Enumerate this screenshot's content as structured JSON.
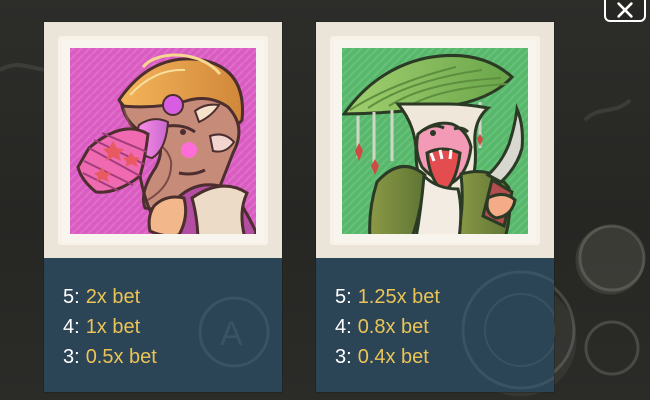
{
  "colors": {
    "background": "#2a2a27",
    "card_footer": "#2b4456",
    "payout_text": "#ebc457",
    "count_text": "#ffffff",
    "close_button": "#ffffff"
  },
  "ui": {
    "close_icon": "close-icon"
  },
  "symbols": [
    {
      "name": "monkey-fan-symbol",
      "pays": [
        {
          "count": "5:",
          "value": "2x bet"
        },
        {
          "count": "4:",
          "value": "1x bet"
        },
        {
          "count": "3:",
          "value": "0.5x bet"
        }
      ]
    },
    {
      "name": "monkey-knife-symbol",
      "pays": [
        {
          "count": "5:",
          "value": "1.25x bet"
        },
        {
          "count": "4:",
          "value": "0.8x bet"
        },
        {
          "count": "3:",
          "value": "0.4x bet"
        }
      ]
    }
  ]
}
